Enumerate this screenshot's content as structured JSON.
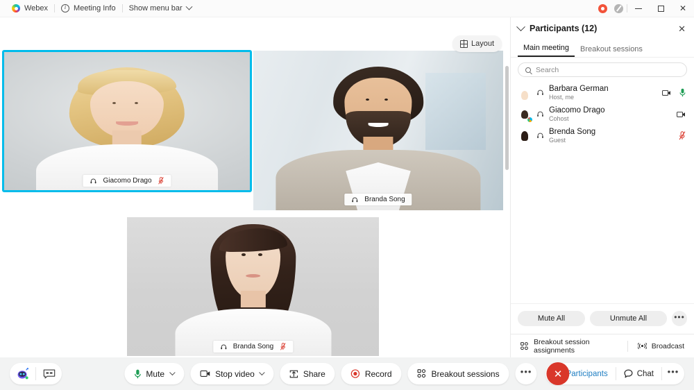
{
  "titlebar": {
    "app_name": "Webex",
    "meeting_info": "Meeting Info",
    "show_menu_bar": "Show menu bar",
    "recording_indicator": "recording-indicator",
    "network_indicator": "network-indicator",
    "minimize": "–",
    "maximize": "□",
    "close": "✕"
  },
  "stage": {
    "layout_button": "Layout",
    "tiles": [
      {
        "name": "Giacomo Drago",
        "muted": true,
        "active_speaker": true
      },
      {
        "name": "Branda Song",
        "muted": false,
        "active_speaker": false
      },
      {
        "name": "Branda Song",
        "muted": true,
        "active_speaker": false
      }
    ]
  },
  "panel": {
    "title": "Participants (12)",
    "close_label": "✕",
    "tabs": [
      {
        "label": "Main meeting",
        "selected": true
      },
      {
        "label": "Breakout sessions",
        "selected": false
      }
    ],
    "search": {
      "placeholder": "Search",
      "value": ""
    },
    "participants": [
      {
        "name": "Barbara German",
        "role": "Host, me",
        "video": true,
        "mic": "unmuted"
      },
      {
        "name": "Giacomo Drago",
        "role": "Cohost",
        "video": true,
        "mic": "none"
      },
      {
        "name": "Brenda Song",
        "role": "Guest",
        "video": false,
        "mic": "muted"
      }
    ],
    "actions": {
      "mute_all": "Mute All",
      "unmute_all": "Unmute All",
      "more": "•••"
    },
    "footer": {
      "breakout_assignments": "Breakout session assignments",
      "broadcast": "Broadcast"
    }
  },
  "controlbar": {
    "assistant_icon": "ai-assistant-icon",
    "captions_icon": "closed-captions-icon",
    "mute": "Mute",
    "stop_video": "Stop video",
    "share": "Share",
    "record": "Record",
    "breakout_sessions": "Breakout sessions",
    "more": "•••",
    "end_meeting": "✕",
    "participants": "Participants",
    "chat": "Chat",
    "right_more": "•••"
  },
  "colors": {
    "brand_cyan": "#00bceb",
    "end_red": "#d9372a",
    "mute_red": "#d9372a",
    "active_green": "#1f9d55",
    "accent_blue": "#1f7ec2"
  }
}
